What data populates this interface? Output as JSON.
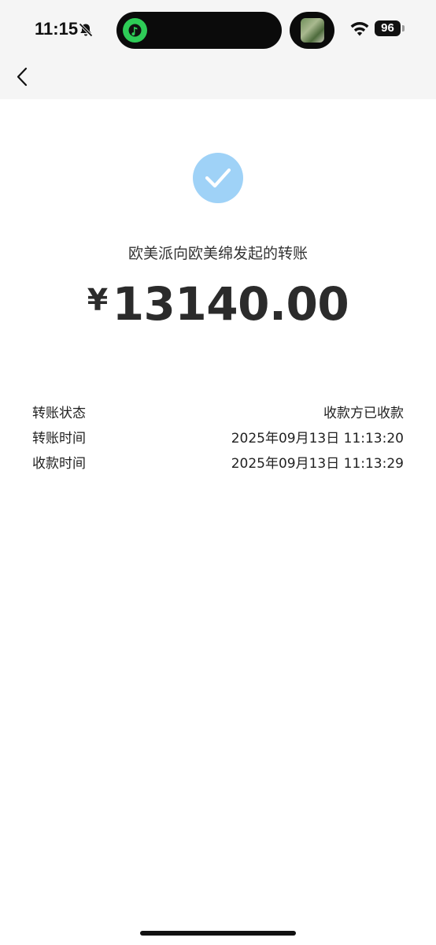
{
  "status_bar": {
    "time": "11:15",
    "battery": "96"
  },
  "transfer": {
    "subtitle": "欧美派向欧美绵发起的转账",
    "currency_symbol": "¥",
    "amount": "13140.00"
  },
  "details": [
    {
      "label": "转账状态",
      "value": "收款方已收款"
    },
    {
      "label": "转账时间",
      "value": "2025年09月13日 11:13:20"
    },
    {
      "label": "收款时间",
      "value": "2025年09月13日 11:13:29"
    }
  ],
  "colors": {
    "check_circle": "#9fd2f7",
    "music_app": "#2ecc57",
    "header_bg": "#f5f5f5"
  }
}
